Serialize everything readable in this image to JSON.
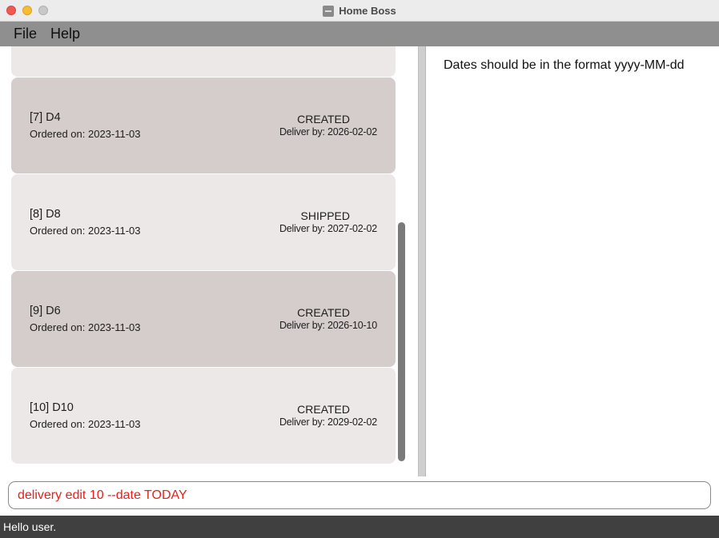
{
  "window": {
    "title": "Home Boss"
  },
  "menu": {
    "items": [
      "File",
      "Help"
    ]
  },
  "deliveries": [
    {
      "name": "",
      "ordered": "",
      "status": "",
      "deliver_by": ""
    },
    {
      "name": "[7] D4",
      "ordered": "Ordered on: 2023-11-03",
      "status": "CREATED",
      "deliver_by": "Deliver by: 2026-02-02"
    },
    {
      "name": "[8] D8",
      "ordered": "Ordered on: 2023-11-03",
      "status": "SHIPPED",
      "deliver_by": "Deliver by: 2027-02-02"
    },
    {
      "name": "[9] D6",
      "ordered": "Ordered on: 2023-11-03",
      "status": "CREATED",
      "deliver_by": "Deliver by: 2026-10-10"
    },
    {
      "name": "[10] D10",
      "ordered": "Ordered on: 2023-11-03",
      "status": "CREATED",
      "deliver_by": "Deliver by: 2029-02-02"
    }
  ],
  "result": {
    "message": "Dates should be in the format yyyy-MM-dd"
  },
  "command": {
    "value": "delivery edit 10 --date TODAY",
    "color": "#e8201a"
  },
  "status": {
    "text": "Hello user."
  },
  "colors": {
    "card_odd": "#d4cdcc",
    "card_even": "#ede8e8",
    "menubar": "#8f8f8f",
    "statusbar": "#404040"
  }
}
